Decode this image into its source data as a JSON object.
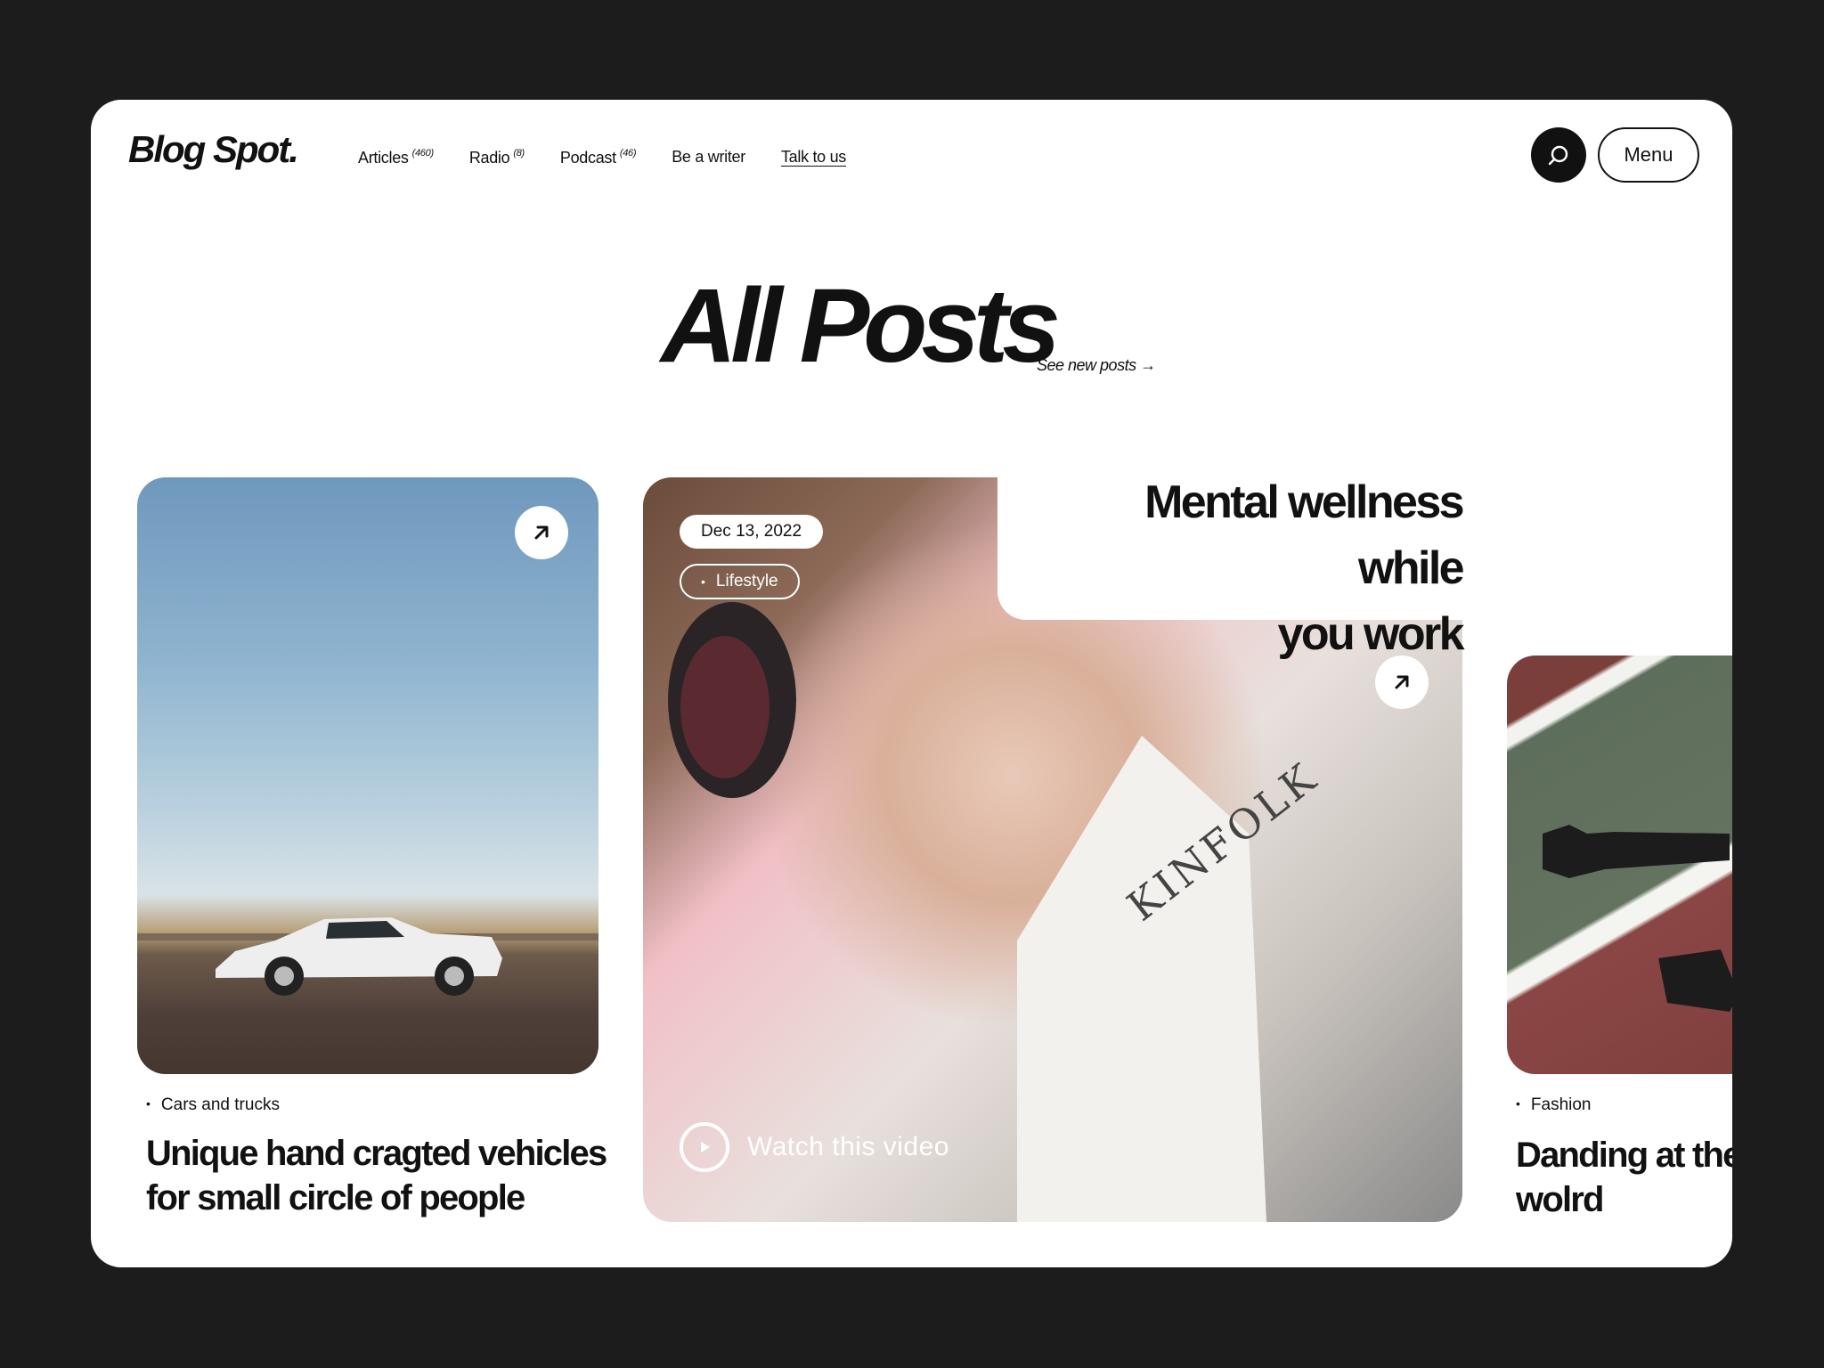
{
  "header": {
    "logo": "Blog Spot.",
    "nav": [
      {
        "label": "Articles",
        "count": "(460)"
      },
      {
        "label": "Radio",
        "count": "(8)"
      },
      {
        "label": "Podcast",
        "count": "(46)"
      },
      {
        "label": "Be a writer",
        "count": ""
      },
      {
        "label": "Talk to us",
        "count": ""
      }
    ],
    "menu_label": "Menu"
  },
  "title": {
    "heading": "All Posts",
    "see_new": "See new posts →"
  },
  "cards": {
    "left": {
      "category": "Cars and trucks",
      "title_line1": "Unique hand cragted vehicles",
      "title_line2": "for small circle of people"
    },
    "feature": {
      "title_line1": "Mental wellness while",
      "title_line2": "you work",
      "date": "Dec 13, 2022",
      "tag": "Lifestyle",
      "cta": "Watch this video"
    },
    "right": {
      "category": "Fashion",
      "title_line1": "Danding at the",
      "title_line2": "wolrd"
    }
  },
  "icons": {
    "search": "search-icon",
    "arrow": "arrow-up-right-icon",
    "play": "play-icon"
  },
  "colors": {
    "background": "#1c1c1c",
    "surface": "#ffffff",
    "text": "#111111"
  }
}
